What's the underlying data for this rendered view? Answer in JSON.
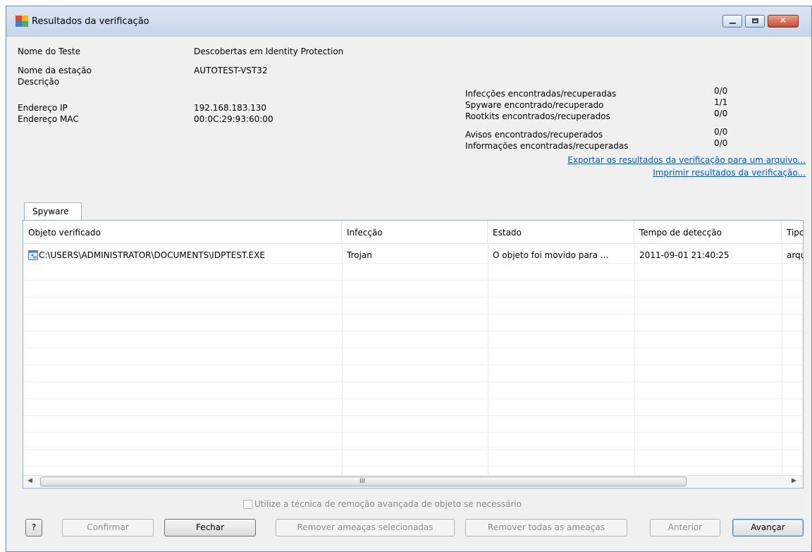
{
  "window": {
    "title": "Resultados da verificação"
  },
  "titlebar_buttons": {
    "minimize_icon": "minimize-icon",
    "maximize_icon": "maximize-icon",
    "close_glyph": "✕"
  },
  "info": {
    "test_name_label": "Nome do Teste",
    "test_name_value": "Descobertas em Identity Protection",
    "station_label": "Nome da estação",
    "station_value": "AUTOTEST-VST32",
    "description_label": "Descrição",
    "ip_label": "Endereço IP",
    "ip_value": "192.168.183.130",
    "mac_label": "Endereço MAC",
    "mac_value": "00:0C:29:93:60:00"
  },
  "stats": {
    "infections_label": "Infecções encontradas/recuperadas",
    "infections_value": "0/0",
    "spyware_label": "Spyware encontrado/recuperado",
    "spyware_value": "1/1",
    "rootkits_label": "Rootkits encontrados/recuperados",
    "rootkits_value": "0/0",
    "warnings_label": "Avisos encontrados/recuperados",
    "warnings_value": "0/0",
    "info_label": "Informações encontradas/recuperadas",
    "info_value": "0/0"
  },
  "links": {
    "export": "Exportar os resultados da verificação para um arquivo...",
    "print": "Imprimir resultados da verificação..."
  },
  "tabs": [
    {
      "label": "Spyware"
    }
  ],
  "table": {
    "columns": [
      "Objeto verificado",
      "Infecção",
      "Estado",
      "Tempo de detecção",
      "Tipo"
    ],
    "rows": [
      {
        "icon": "exe-file-icon",
        "object": "C:\\USERS\\ADMINISTRATOR\\DOCUMENTS\\IDPTEST.EXE",
        "infection": "Trojan",
        "state": "O objeto foi movido para ...",
        "time": "2011-09-01 21:40:25",
        "type": "arqu"
      }
    ]
  },
  "scrollbar": {
    "left_arrow": "◀",
    "right_arrow": "▶",
    "grip": "III"
  },
  "option": {
    "label": "Utilize a técnica de remoção avançada de objeto se necessário",
    "checked": false
  },
  "buttons": {
    "help": "?",
    "confirm": "Confirmar",
    "close": "Fechar",
    "remove_selected": "Remover ameaças selecionadas",
    "remove_all": "Remover todas as ameaças",
    "previous": "Anterior",
    "next": "Avançar"
  },
  "colors": {
    "link": "#0a5ac8",
    "titlebar": "#c5d6ea",
    "dialog_bg": "#f0f0f0"
  }
}
